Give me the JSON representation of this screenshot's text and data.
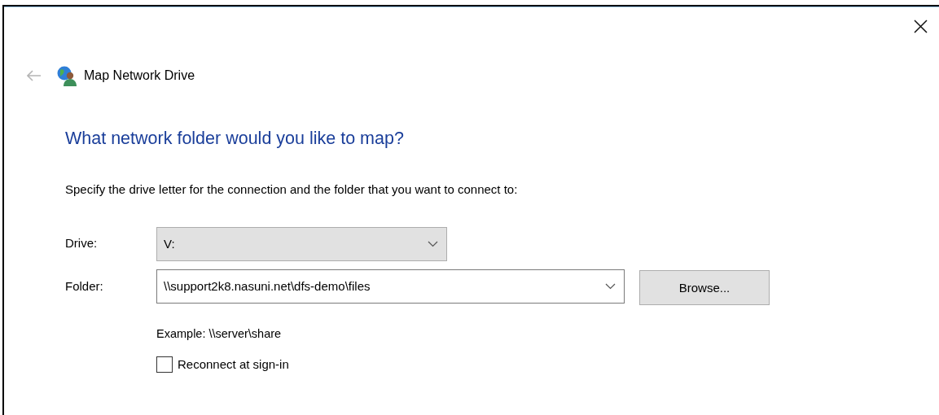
{
  "window": {
    "title": "Map Network Drive"
  },
  "heading": "What network folder would you like to map?",
  "instruction": "Specify the drive letter for the connection and the folder that you want to connect to:",
  "drive": {
    "label": "Drive:",
    "value": "V:"
  },
  "folder": {
    "label": "Folder:",
    "value": "\\\\support2k8.nasuni.net\\dfs-demo\\files"
  },
  "browse_button": {
    "label": "Browse..."
  },
  "example": "Example: \\\\server\\share",
  "reconnect": {
    "label": "Reconnect at sign-in",
    "checked": false
  }
}
